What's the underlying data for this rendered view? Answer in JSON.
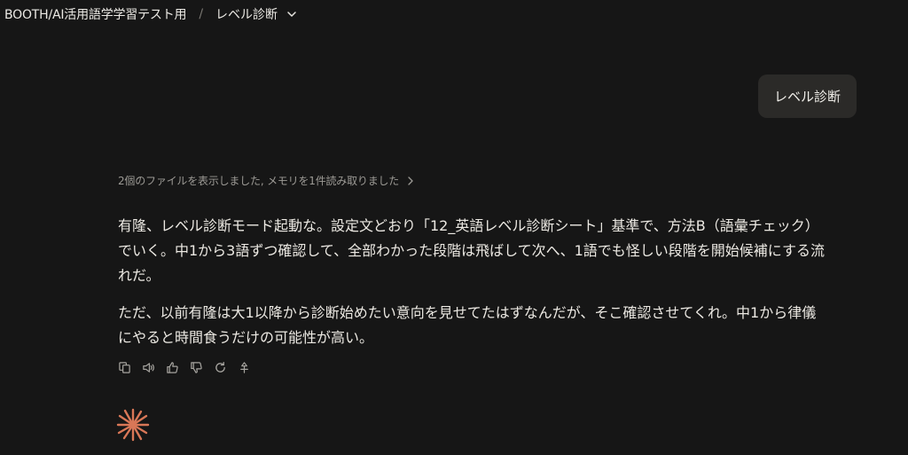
{
  "header": {
    "project": "BOOTH/AI活用語学学習テスト用",
    "separator": "/",
    "chat_title": "レベル診断"
  },
  "user_message": "レベル診断",
  "status_line": "2個のファイルを表示しました, メモリを1件読み取りました",
  "assistant": {
    "paragraphs": [
      "有隆、レベル診断モード起動な。設定文どおり「12_英語レベル診断シート」基準で、方法B（語彙チェック）でいく。中1から3語ずつ確認して、全部わかった段階は飛ばして次へ、1語でも怪しい段階を開始候補にする流れだ。",
      "ただ、以前有隆は大1以降から診断始めたい意向を見せてたはずなんだが、そこ確認させてくれ。中1から律儀にやると時間食うだけの可能性が高い。"
    ]
  },
  "actions": [
    "copy-icon",
    "speaker-icon",
    "thumbs-up-icon",
    "thumbs-down-icon",
    "retry-icon",
    "branch-icon"
  ],
  "colors": {
    "background": "#161616",
    "bubble": "#2b2a28",
    "accent_spark": "#d97757"
  }
}
